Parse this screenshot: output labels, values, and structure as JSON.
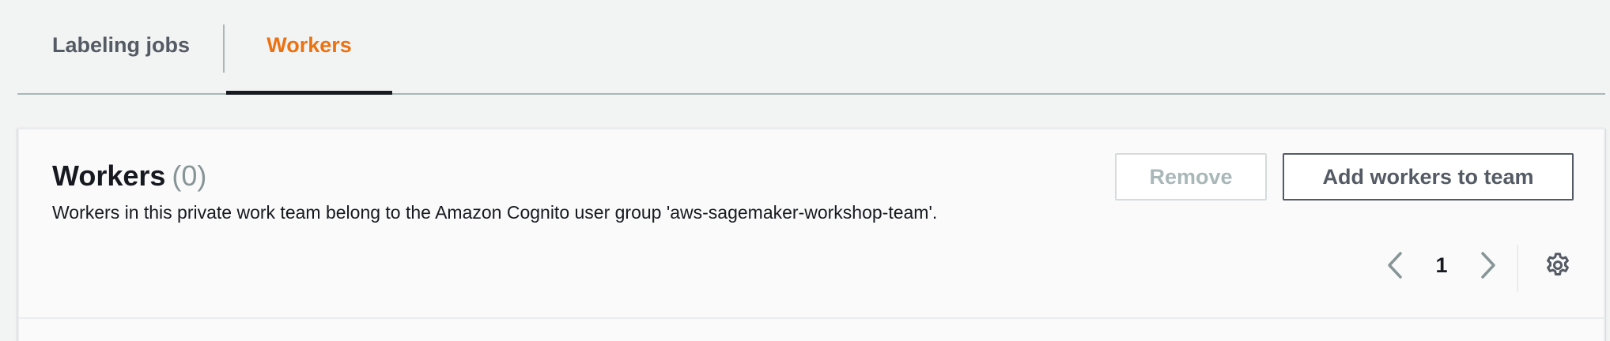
{
  "tabs": [
    {
      "label": "Labeling jobs",
      "active": false
    },
    {
      "label": "Workers",
      "active": true
    }
  ],
  "panel": {
    "title": "Workers",
    "count": "(0)",
    "description": "Workers in this private work team belong to the Amazon Cognito user group 'aws-sagemaker-workshop-team'.",
    "remove_label": "Remove",
    "add_label": "Add workers to team"
  },
  "pagination": {
    "current_page": "1",
    "prev_icon": "chevron-left-icon",
    "next_icon": "chevron-right-icon",
    "settings_icon": "gear-icon"
  },
  "colors": {
    "active_tab": "#ec7211",
    "inactive_tab": "#545b64",
    "text": "#16191f",
    "muted": "#879596",
    "disabled": "#aab7b8"
  }
}
